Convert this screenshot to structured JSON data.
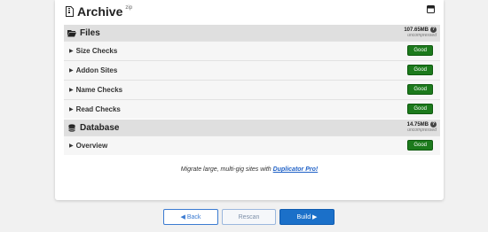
{
  "archive": {
    "title": "Archive",
    "superscript": "zip"
  },
  "files": {
    "title": "Files",
    "size": "107.65MB",
    "size_note": "uncompressed",
    "rows": [
      {
        "label": "Size Checks",
        "status": "Good"
      },
      {
        "label": "Addon Sites",
        "status": "Good"
      },
      {
        "label": "Name Checks",
        "status": "Good"
      },
      {
        "label": "Read Checks",
        "status": "Good"
      }
    ]
  },
  "database": {
    "title": "Database",
    "size": "14.75MB",
    "size_note": "uncompressed",
    "rows": [
      {
        "label": "Overview",
        "status": "Good"
      }
    ]
  },
  "promo": {
    "text": "Migrate large, multi-gig sites with",
    "link": "Duplicator Pro!"
  },
  "buttons": {
    "back": "◀ Back",
    "rescan": "Rescan",
    "build": "Build ▶"
  },
  "colors": {
    "good_badge": "#1c7a1c",
    "link": "#1f61c7",
    "primary_button": "#1b70c9"
  },
  "icons": {
    "archive": "file-zip-icon",
    "toggle": "window-toggle-icon",
    "files": "folder-open-icon",
    "database": "database-icon",
    "help": "question-circle-icon",
    "expand": "caret-right-icon"
  }
}
